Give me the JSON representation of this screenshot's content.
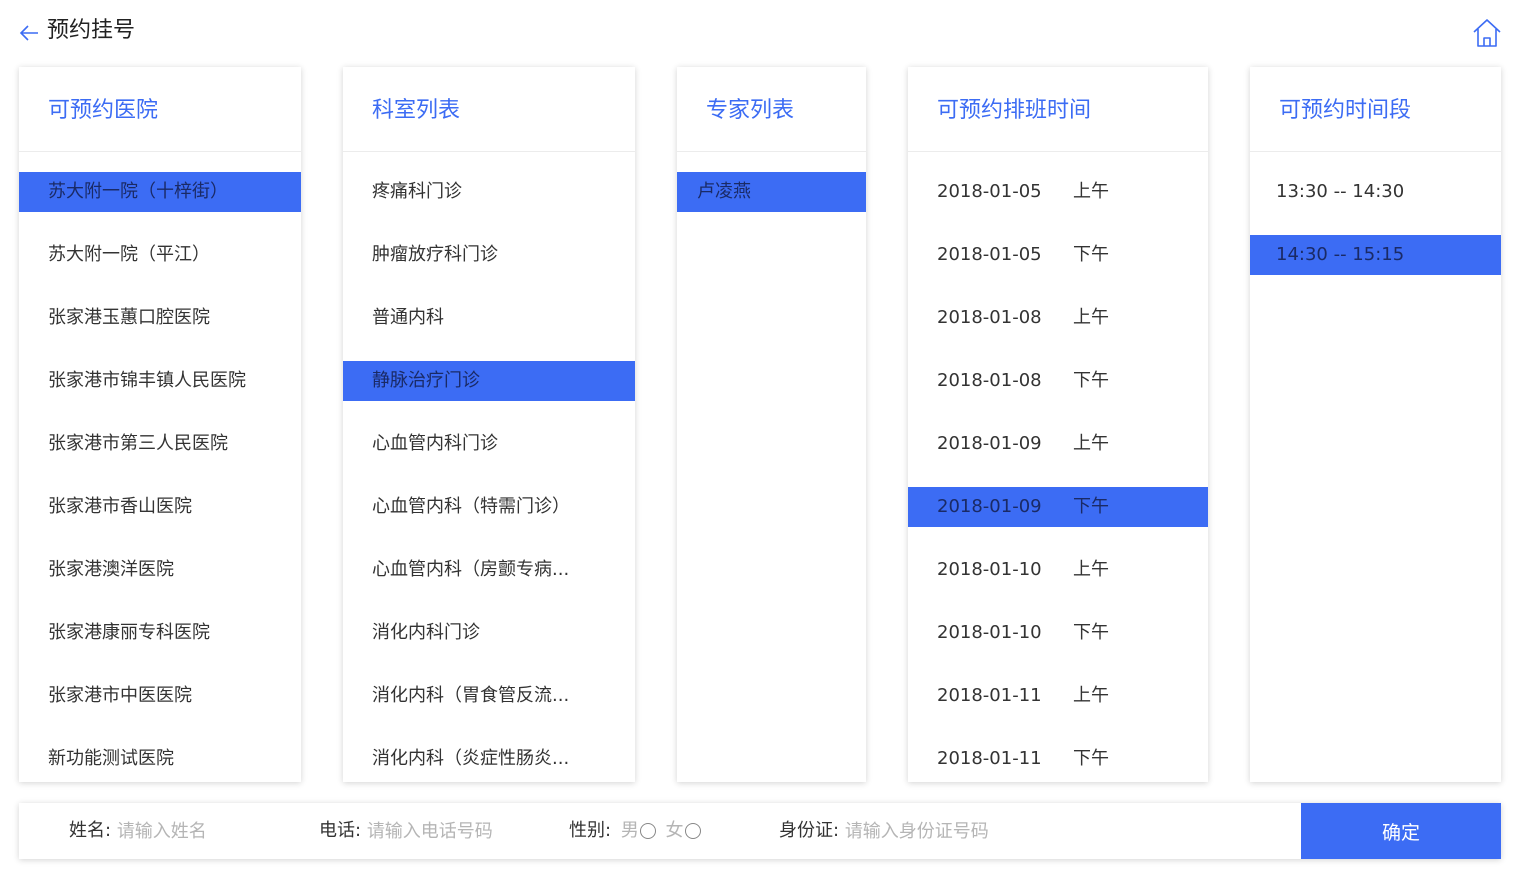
{
  "header": {
    "title": "预约挂号",
    "back_icon": "arrow-left-icon",
    "home_icon": "home-icon",
    "accent_color": "#3c6cf4"
  },
  "hospitals": {
    "title": "可预约医院",
    "items": [
      "苏大附一院（十梓街）",
      "苏大附一院（平江）",
      "张家港玉蕙口腔医院",
      "张家港市锦丰镇人民医院",
      "张家港市第三人民医院",
      "张家港市香山医院",
      "张家港澳洋医院",
      "张家港康丽专科医院",
      "张家港市中医医院",
      "新功能测试医院"
    ],
    "selected": "苏大附一院（十梓街）"
  },
  "departments": {
    "title": "科室列表",
    "items": [
      "疼痛科门诊",
      "肿瘤放疗科门诊",
      "普通内科",
      "静脉治疗门诊",
      "心血管内科门诊",
      "心血管内科（特需门诊）",
      "心血管内科（房颤专病...",
      "消化内科门诊",
      "消化内科（胃食管反流...",
      "消化内科（炎症性肠炎..."
    ],
    "selected": "静脉治疗门诊"
  },
  "experts": {
    "title": "专家列表",
    "items": [
      "卢凌燕"
    ],
    "selected": "卢凌燕"
  },
  "schedule": {
    "title": "可预约排班时间",
    "items": [
      {
        "date": "2018-01-05",
        "period": "上午"
      },
      {
        "date": "2018-01-05",
        "period": "下午"
      },
      {
        "date": "2018-01-08",
        "period": "上午"
      },
      {
        "date": "2018-01-08",
        "period": "下午"
      },
      {
        "date": "2018-01-09",
        "period": "上午"
      },
      {
        "date": "2018-01-09",
        "period": "下午"
      },
      {
        "date": "2018-01-10",
        "period": "上午"
      },
      {
        "date": "2018-01-10",
        "period": "下午"
      },
      {
        "date": "2018-01-11",
        "period": "上午"
      },
      {
        "date": "2018-01-11",
        "period": "下午"
      }
    ],
    "selected": "2018-01-09 下午"
  },
  "timeslots": {
    "title": "可预约时间段",
    "items": [
      "13:30 -- 14:30",
      "14:30 -- 15:15"
    ],
    "selected": "14:30 -- 15:15"
  },
  "form": {
    "name_label": "姓名:",
    "name_placeholder": "请输入姓名",
    "phone_label": "电话:",
    "phone_placeholder": "请输入电话号码",
    "gender_label": "性别:",
    "gender_options": [
      "男",
      "女"
    ],
    "id_label": "身份证:",
    "id_placeholder": "请输入身份证号码",
    "confirm_label": "确定"
  }
}
